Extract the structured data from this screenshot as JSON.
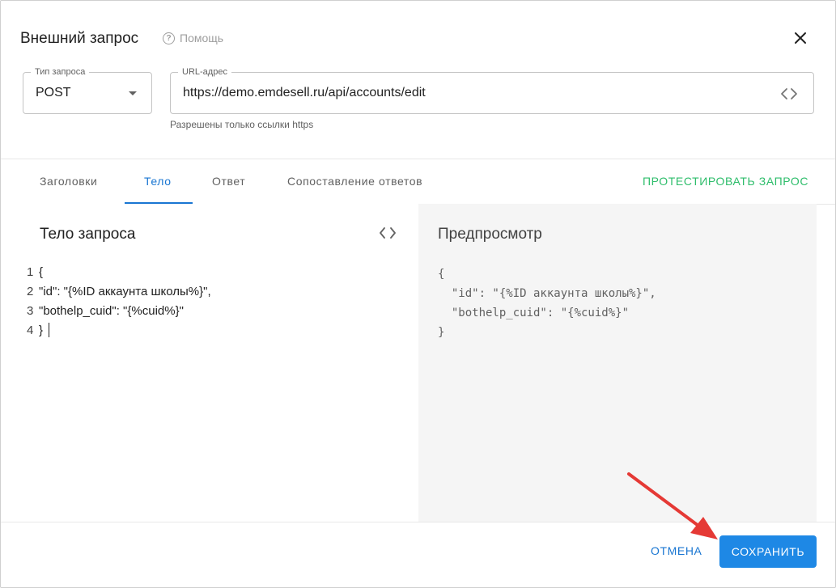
{
  "dialog": {
    "title": "Внешний запрос",
    "help_label": "Помощь",
    "help_icon_glyph": "?"
  },
  "method": {
    "label": "Тип запроса",
    "value": "POST"
  },
  "url": {
    "label": "URL-адрес",
    "value": "https://demo.emdesell.ru/api/accounts/edit",
    "helper": "Разрешены только ссылки https"
  },
  "tabs": [
    {
      "label": "Заголовки",
      "active": false
    },
    {
      "label": "Тело",
      "active": true
    },
    {
      "label": "Ответ",
      "active": false
    },
    {
      "label": "Сопоставление ответов",
      "active": false
    }
  ],
  "test_button": "ПРОТЕСТИРОВАТЬ ЗАПРОС",
  "body_editor": {
    "title": "Тело запроса",
    "lines": [
      {
        "num": "1",
        "text": "{"
      },
      {
        "num": "2",
        "text": "\"id\": \"{%ID аккаунта школы%}\","
      },
      {
        "num": "3",
        "text": "\"bothelp_cuid\": \"{%cuid%}\""
      },
      {
        "num": "4",
        "text": "}"
      }
    ]
  },
  "preview": {
    "title": "Предпросмотр",
    "content": "{\n  \"id\": \"{%ID аккаунта школы%}\",\n  \"bothelp_cuid\": \"{%cuid%}\"\n}"
  },
  "footer": {
    "cancel_label": "ОТМЕНА",
    "save_label": "СОХРАНИТЬ"
  },
  "colors": {
    "primary": "#1e88e5",
    "tab_active": "#1976d2",
    "test_button": "#2ebd6b",
    "annotation_arrow": "#e53935",
    "preview_bg": "#f5f5f5"
  }
}
